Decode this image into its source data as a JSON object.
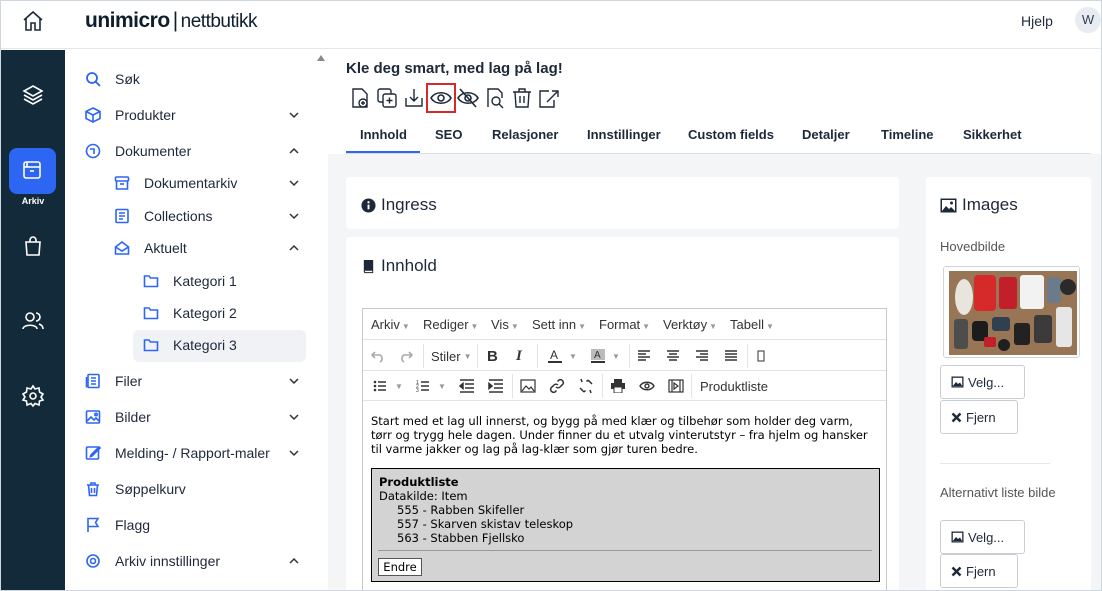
{
  "header": {
    "brand": "unimicro",
    "brand_separator": "|",
    "brand_sub": "nettbutikk",
    "help_label": "Hjelp",
    "avatar_initial": "W"
  },
  "rail": {
    "active_label": "Arkiv"
  },
  "sidebar": {
    "items": [
      {
        "label": "Søk"
      },
      {
        "label": "Produkter"
      },
      {
        "label": "Dokumenter"
      },
      {
        "label": "Dokumentarkiv"
      },
      {
        "label": "Collections"
      },
      {
        "label": "Aktuelt"
      },
      {
        "label": "Kategori 1"
      },
      {
        "label": "Kategori 2"
      },
      {
        "label": "Kategori 3"
      },
      {
        "label": "Filer"
      },
      {
        "label": "Bilder"
      },
      {
        "label": "Melding- / Rapport-maler"
      },
      {
        "label": "Søppelkurv"
      },
      {
        "label": "Flagg"
      },
      {
        "label": "Arkiv innstillinger"
      }
    ]
  },
  "page": {
    "title": "Kle deg smart, med lag på lag!"
  },
  "tabs": [
    "Innhold",
    "SEO",
    "Relasjoner",
    "Innstillinger",
    "Custom fields",
    "Detaljer",
    "Timeline",
    "Sikkerhet"
  ],
  "cards": {
    "ingress_title": "Ingress",
    "innhold_title": "Innhold",
    "images_title": "Images"
  },
  "editor": {
    "menus": [
      "Arkiv",
      "Rediger",
      "Vis",
      "Sett inn",
      "Format",
      "Verktøy",
      "Tabell"
    ],
    "styles_label": "Stiler",
    "produktliste_button": "Produktliste",
    "text": "Start med et lag ull innerst, og bygg på med klær og tilbehør som holder deg varm, tørr og trygg hele dagen. Under finner du et utvalg vinterutstyr – fra hjelm og hansker til varme jakker og lag på lag-klær som gjør turen bedre.",
    "productlist": {
      "title": "Produktliste",
      "datasource": "Datakilde: Item",
      "items": [
        "555 - Rabben Skifeller",
        "557 - Skarven skistav teleskop",
        "563 - Stabben Fjellsko"
      ],
      "button": "Endre"
    }
  },
  "images": {
    "main_label": "Hovedbilde",
    "alt_label": "Alternativt liste bilde",
    "select_label": "Velg...",
    "remove_label": "Fjern"
  },
  "colors": {
    "accent": "#2d66f2",
    "rail": "#122a3a",
    "highlight": "#d62a2a"
  }
}
